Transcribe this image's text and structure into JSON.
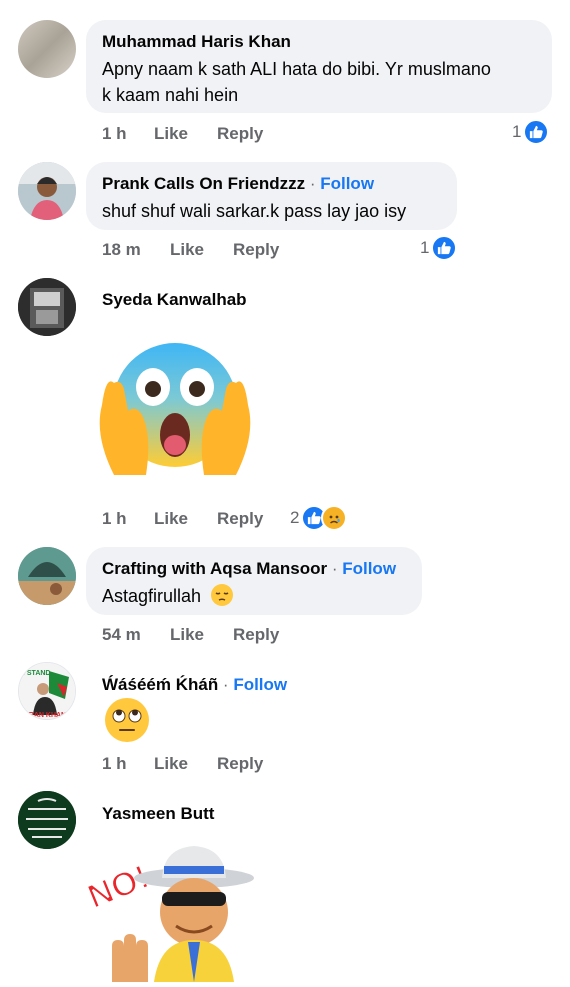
{
  "comments": [
    {
      "name": "Muhammad Haris Khan",
      "line1": "Apny naam k sath ALI hata do bibi. Yr muslmano",
      "line2": "k kaam nahi hein",
      "time": "1 h",
      "like": "Like",
      "reply": "Reply",
      "reactions": "1"
    },
    {
      "name": "Prank Calls On Friendzzz",
      "dot": " · ",
      "follow": "Follow",
      "line1": "shuf shuf wali sarkar.k pass lay jao isy",
      "time": "18 m",
      "like": "Like",
      "reply": "Reply",
      "reactions": "1"
    },
    {
      "name": "Syeda Kanwalhab",
      "time": "1 h",
      "like": "Like",
      "reply": "Reply",
      "reactions": "2",
      "sticker": "screaming-face-sticker"
    },
    {
      "name": "Crafting with Aqsa Mansoor",
      "dot": " · ",
      "follow": "Follow",
      "line1": "Astagfirullah",
      "time": "54 m",
      "like": "Like",
      "reply": "Reply"
    },
    {
      "name": "Ẃáśééḿ Ḱháñ",
      "dot": " · ",
      "follow": "Follow",
      "time": "1 h",
      "like": "Like",
      "reply": "Reply",
      "avatar_text1": "I STAND",
      "avatar_text2": "IMRAN KHAN"
    },
    {
      "name": "Yasmeen Butt",
      "sticker_text": "NO!"
    }
  ],
  "colors": {
    "accent": "#1877f2",
    "bubble": "#f0f2f5",
    "muted": "#65676b"
  }
}
